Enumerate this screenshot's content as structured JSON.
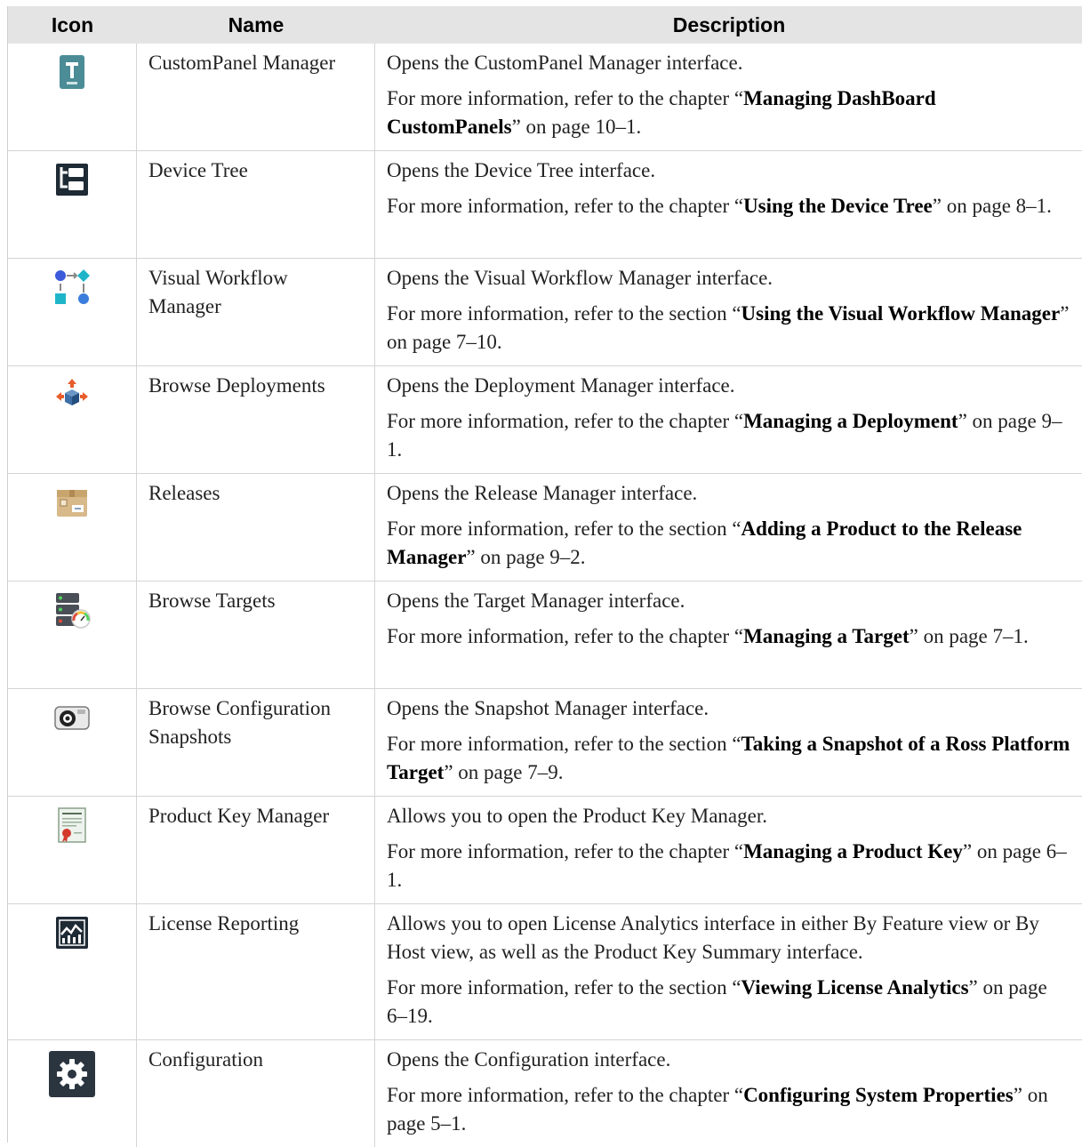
{
  "header": {
    "icon": "Icon",
    "name": "Name",
    "description": "Description"
  },
  "rows": [
    {
      "icon": "custompanel-icon",
      "name": "CustomPanel Manager",
      "desc": "Opens the CustomPanel Manager interface.",
      "more_pre": "For more information, refer to the chapter “",
      "more_bold": "Managing DashBoard CustomPanels",
      "more_post": "” on page 10–1."
    },
    {
      "icon": "device-tree-icon",
      "name": "Device Tree",
      "desc": "Opens the Device Tree interface.",
      "more_pre": "For more information, refer to the chapter “",
      "more_bold": "Using the Device Tree",
      "more_post": "” on page 8–1."
    },
    {
      "icon": "visual-workflow-icon",
      "name": "Visual Workflow Manager",
      "desc": "Opens the Visual Workflow Manager interface.",
      "more_pre": "For more information, refer to the section “",
      "more_bold": "Using the Visual Workflow Manager",
      "more_post": "” on page 7–10."
    },
    {
      "icon": "deployment-icon",
      "name": "Browse Deployments",
      "desc": "Opens the Deployment Manager interface.",
      "more_pre": "For more information, refer to the chapter “",
      "more_bold": "Managing a Deployment",
      "more_post": "” on page 9–1."
    },
    {
      "icon": "package-box-icon",
      "name": "Releases",
      "desc": "Opens the Release Manager interface.",
      "more_pre": "For more information, refer to the section “",
      "more_bold": "Adding a Product to the Release Manager",
      "more_post": "” on page 9–2."
    },
    {
      "icon": "server-targets-icon",
      "name": "Browse Targets",
      "desc": "Opens the Target Manager interface.",
      "more_pre": "For more information, refer to the chapter “",
      "more_bold": "Managing a Target",
      "more_post": "” on page 7–1."
    },
    {
      "icon": "camera-snapshot-icon",
      "name": "Browse Configuration Snapshots",
      "desc": "Opens the Snapshot Manager interface.",
      "more_pre": "For more information, refer to the section “",
      "more_bold": "Taking a Snapshot of a Ross Platform Target",
      "more_post": "” on page 7–9."
    },
    {
      "icon": "certificate-icon",
      "name": "Product Key Manager",
      "desc": "Allows you to open the Product Key Manager.",
      "more_pre": "For more information, refer to the chapter “",
      "more_bold": "Managing a Product Key",
      "more_post": "” on page 6–1."
    },
    {
      "icon": "analytics-chart-icon",
      "name": "License Reporting",
      "desc": "Allows you to open License Analytics interface in either By Feature view or By Host view, as well as the Product Key Summary interface.",
      "more_pre": "For more information, refer to the section “",
      "more_bold": "Viewing License Analytics",
      "more_post": "” on page 6–19."
    },
    {
      "icon": "gear-icon",
      "name": "Configuration",
      "desc": "Opens the Configuration interface.",
      "more_pre": "For more information, refer to the chapter “",
      "more_bold": "Configuring System Properties",
      "more_post": "” on page 5–1."
    }
  ]
}
